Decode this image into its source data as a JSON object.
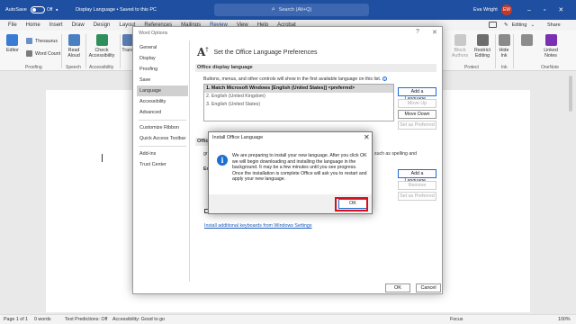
{
  "titlebar": {
    "autosave_label": "AutoSave",
    "autosave_state": "Off",
    "doc_title": "Display Language • Saved to this PC",
    "search_placeholder": "Search (Alt+Q)",
    "user_name": "Eva Wright",
    "user_initials": "EW"
  },
  "tabs": [
    "File",
    "Home",
    "Insert",
    "Draw",
    "Design",
    "Layout",
    "References",
    "Mailings",
    "Review",
    "View",
    "Help",
    "Acrobat"
  ],
  "active_tab": "Review",
  "ribbon": {
    "editor": "Editor",
    "thesaurus": "Thesaurus",
    "word_count": "Word Count",
    "proofing_group": "Proofing",
    "read_aloud": "Read Aloud",
    "speech_group": "Speech",
    "check_accessibility": "Check Accessibility",
    "accessibility_group": "Accessibility",
    "translate": "Trans",
    "block_authors": "Block Authors",
    "restrict_editing": "Restrict Editing",
    "protect_group": "Protect",
    "hide_ink": "Hide Ink",
    "ink_group": "Ink",
    "linked_notes": "Linked Notes",
    "onenote_group": "OneNote",
    "editing_mode": "Editing",
    "share": "Share"
  },
  "word_options": {
    "title": "Word Options",
    "help": "?",
    "close": "✕",
    "nav": [
      "General",
      "Display",
      "Proofing",
      "Save",
      "Language",
      "Accessibility",
      "Advanced",
      "Customize Ribbon",
      "Quick Access Toolbar",
      "Add-ins",
      "Trust Center"
    ],
    "selected_nav": "Language",
    "heading": "Set the Office Language Preferences",
    "display_section": "Office display language",
    "display_desc": "Buttons, menus, and other controls will show in the first available language on this list.",
    "display_languages": [
      "1.   Match Microsoft Windows [English (United States)] <preferred>",
      "2.   English (United Kingdom)",
      "3.   English (United States)"
    ],
    "add_language": "Add a Language...",
    "move_up": "Move Up",
    "move_down": "Move Down",
    "set_preferred": "Set as Preferred",
    "authoring_section": "Office",
    "authoring_desc_tail": "such as spelling and",
    "authoring_desc_start": "gr",
    "authoring_label_e": "En",
    "add_language_2": "Add a Language...",
    "remove": "Remove",
    "set_preferred_2": "Set as Preferred",
    "keyboards_link": "Install additional keyboards from Windows Settings",
    "ok": "OK",
    "cancel": "Cancel"
  },
  "install_dialog": {
    "title": "Install Office Language",
    "close": "✕",
    "message": "We are preparing to install your new language. After you click OK we will begin downloading and installing the language in the background. It may be a few minutes until you see progress. Once the installation is complete Office will ask you to restart and apply your new language.",
    "ok": "OK"
  },
  "status": {
    "page": "Page 1 of 1",
    "words": "0 words",
    "text_predictions": "Text Predictions: Off",
    "accessibility": "Accessibility: Good to go",
    "focus": "Focus",
    "zoom": "100%"
  },
  "colors": {
    "title_bar": "#1e4fa1",
    "highlight": "#d8101b",
    "info_icon": "#1b6fd1"
  }
}
